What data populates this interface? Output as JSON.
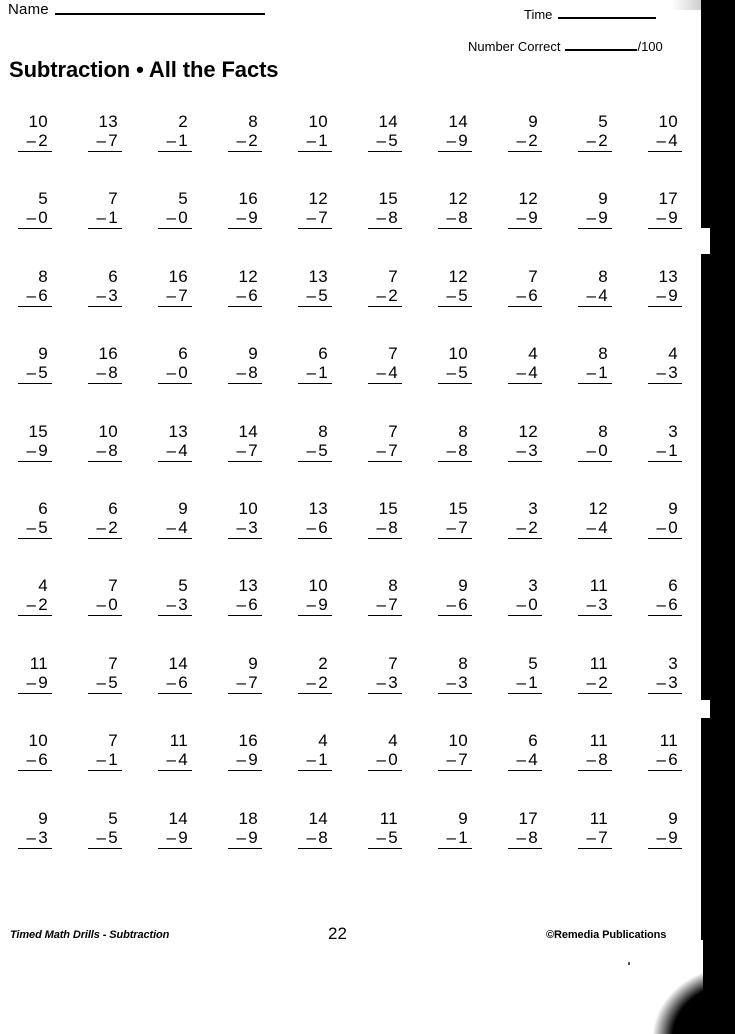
{
  "header": {
    "name_label": "Name",
    "time_label": "Time",
    "number_correct_label": "Number  Correct",
    "number_correct_suffix": "/100",
    "title": "Subtraction • All the Facts"
  },
  "footer": {
    "left": "Timed Math Drills - Subtraction",
    "page": "22",
    "right": "©Remedia Publications"
  },
  "worksheet": {
    "operator": "–",
    "columns": 10,
    "rows": 10,
    "total_problems": 100,
    "problems": [
      [
        {
          "minuend": "10",
          "subtrahend": "2"
        },
        {
          "minuend": "13",
          "subtrahend": "7"
        },
        {
          "minuend": "2",
          "subtrahend": "1"
        },
        {
          "minuend": "8",
          "subtrahend": "2"
        },
        {
          "minuend": "10",
          "subtrahend": "1"
        },
        {
          "minuend": "14",
          "subtrahend": "5"
        },
        {
          "minuend": "14",
          "subtrahend": "9"
        },
        {
          "minuend": "9",
          "subtrahend": "2"
        },
        {
          "minuend": "5",
          "subtrahend": "2"
        },
        {
          "minuend": "10",
          "subtrahend": "4"
        }
      ],
      [
        {
          "minuend": "5",
          "subtrahend": "0"
        },
        {
          "minuend": "7",
          "subtrahend": "1"
        },
        {
          "minuend": "5",
          "subtrahend": "0"
        },
        {
          "minuend": "16",
          "subtrahend": "9"
        },
        {
          "minuend": "12",
          "subtrahend": "7"
        },
        {
          "minuend": "15",
          "subtrahend": "8"
        },
        {
          "minuend": "12",
          "subtrahend": "8"
        },
        {
          "minuend": "12",
          "subtrahend": "9"
        },
        {
          "minuend": "9",
          "subtrahend": "9"
        },
        {
          "minuend": "17",
          "subtrahend": "9"
        }
      ],
      [
        {
          "minuend": "8",
          "subtrahend": "6"
        },
        {
          "minuend": "6",
          "subtrahend": "3"
        },
        {
          "minuend": "16",
          "subtrahend": "7"
        },
        {
          "minuend": "12",
          "subtrahend": "6"
        },
        {
          "minuend": "13",
          "subtrahend": "5"
        },
        {
          "minuend": "7",
          "subtrahend": "2"
        },
        {
          "minuend": "12",
          "subtrahend": "5"
        },
        {
          "minuend": "7",
          "subtrahend": "6"
        },
        {
          "minuend": "8",
          "subtrahend": "4"
        },
        {
          "minuend": "13",
          "subtrahend": "9"
        }
      ],
      [
        {
          "minuend": "9",
          "subtrahend": "5"
        },
        {
          "minuend": "16",
          "subtrahend": "8"
        },
        {
          "minuend": "6",
          "subtrahend": "0"
        },
        {
          "minuend": "9",
          "subtrahend": "8"
        },
        {
          "minuend": "6",
          "subtrahend": "1"
        },
        {
          "minuend": "7",
          "subtrahend": "4"
        },
        {
          "minuend": "10",
          "subtrahend": "5"
        },
        {
          "minuend": "4",
          "subtrahend": "4"
        },
        {
          "minuend": "8",
          "subtrahend": "1"
        },
        {
          "minuend": "4",
          "subtrahend": "3"
        }
      ],
      [
        {
          "minuend": "15",
          "subtrahend": "9"
        },
        {
          "minuend": "10",
          "subtrahend": "8"
        },
        {
          "minuend": "13",
          "subtrahend": "4"
        },
        {
          "minuend": "14",
          "subtrahend": "7"
        },
        {
          "minuend": "8",
          "subtrahend": "5"
        },
        {
          "minuend": "7",
          "subtrahend": "7"
        },
        {
          "minuend": "8",
          "subtrahend": "8"
        },
        {
          "minuend": "12",
          "subtrahend": "3"
        },
        {
          "minuend": "8",
          "subtrahend": "0"
        },
        {
          "minuend": "3",
          "subtrahend": "1"
        }
      ],
      [
        {
          "minuend": "6",
          "subtrahend": "5"
        },
        {
          "minuend": "6",
          "subtrahend": "2"
        },
        {
          "minuend": "9",
          "subtrahend": "4"
        },
        {
          "minuend": "10",
          "subtrahend": "3"
        },
        {
          "minuend": "13",
          "subtrahend": "6"
        },
        {
          "minuend": "15",
          "subtrahend": "8"
        },
        {
          "minuend": "15",
          "subtrahend": "7"
        },
        {
          "minuend": "3",
          "subtrahend": "2"
        },
        {
          "minuend": "12",
          "subtrahend": "4"
        },
        {
          "minuend": "9",
          "subtrahend": "0"
        }
      ],
      [
        {
          "minuend": "4",
          "subtrahend": "2"
        },
        {
          "minuend": "7",
          "subtrahend": "0"
        },
        {
          "minuend": "5",
          "subtrahend": "3"
        },
        {
          "minuend": "13",
          "subtrahend": "6"
        },
        {
          "minuend": "10",
          "subtrahend": "9"
        },
        {
          "minuend": "8",
          "subtrahend": "7"
        },
        {
          "minuend": "9",
          "subtrahend": "6"
        },
        {
          "minuend": "3",
          "subtrahend": "0"
        },
        {
          "minuend": "11",
          "subtrahend": "3"
        },
        {
          "minuend": "6",
          "subtrahend": "6"
        }
      ],
      [
        {
          "minuend": "11",
          "subtrahend": "9"
        },
        {
          "minuend": "7",
          "subtrahend": "5"
        },
        {
          "minuend": "14",
          "subtrahend": "6"
        },
        {
          "minuend": "9",
          "subtrahend": "7"
        },
        {
          "minuend": "2",
          "subtrahend": "2"
        },
        {
          "minuend": "7",
          "subtrahend": "3"
        },
        {
          "minuend": "8",
          "subtrahend": "3"
        },
        {
          "minuend": "5",
          "subtrahend": "1"
        },
        {
          "minuend": "11",
          "subtrahend": "2"
        },
        {
          "minuend": "3",
          "subtrahend": "3"
        }
      ],
      [
        {
          "minuend": "10",
          "subtrahend": "6"
        },
        {
          "minuend": "7",
          "subtrahend": "1"
        },
        {
          "minuend": "11",
          "subtrahend": "4"
        },
        {
          "minuend": "16",
          "subtrahend": "9"
        },
        {
          "minuend": "4",
          "subtrahend": "1"
        },
        {
          "minuend": "4",
          "subtrahend": "0"
        },
        {
          "minuend": "10",
          "subtrahend": "7"
        },
        {
          "minuend": "6",
          "subtrahend": "4"
        },
        {
          "minuend": "11",
          "subtrahend": "8"
        },
        {
          "minuend": "11",
          "subtrahend": "6"
        }
      ],
      [
        {
          "minuend": "9",
          "subtrahend": "3"
        },
        {
          "minuend": "5",
          "subtrahend": "5"
        },
        {
          "minuend": "14",
          "subtrahend": "9"
        },
        {
          "minuend": "18",
          "subtrahend": "9"
        },
        {
          "minuend": "14",
          "subtrahend": "8"
        },
        {
          "minuend": "11",
          "subtrahend": "5"
        },
        {
          "minuend": "9",
          "subtrahend": "1"
        },
        {
          "minuend": "17",
          "subtrahend": "8"
        },
        {
          "minuend": "11",
          "subtrahend": "7"
        },
        {
          "minuend": "9",
          "subtrahend": "9"
        }
      ]
    ]
  },
  "colors": {
    "ink": "#000000",
    "paper": "#ffffff",
    "scan_edge": "#000000"
  }
}
